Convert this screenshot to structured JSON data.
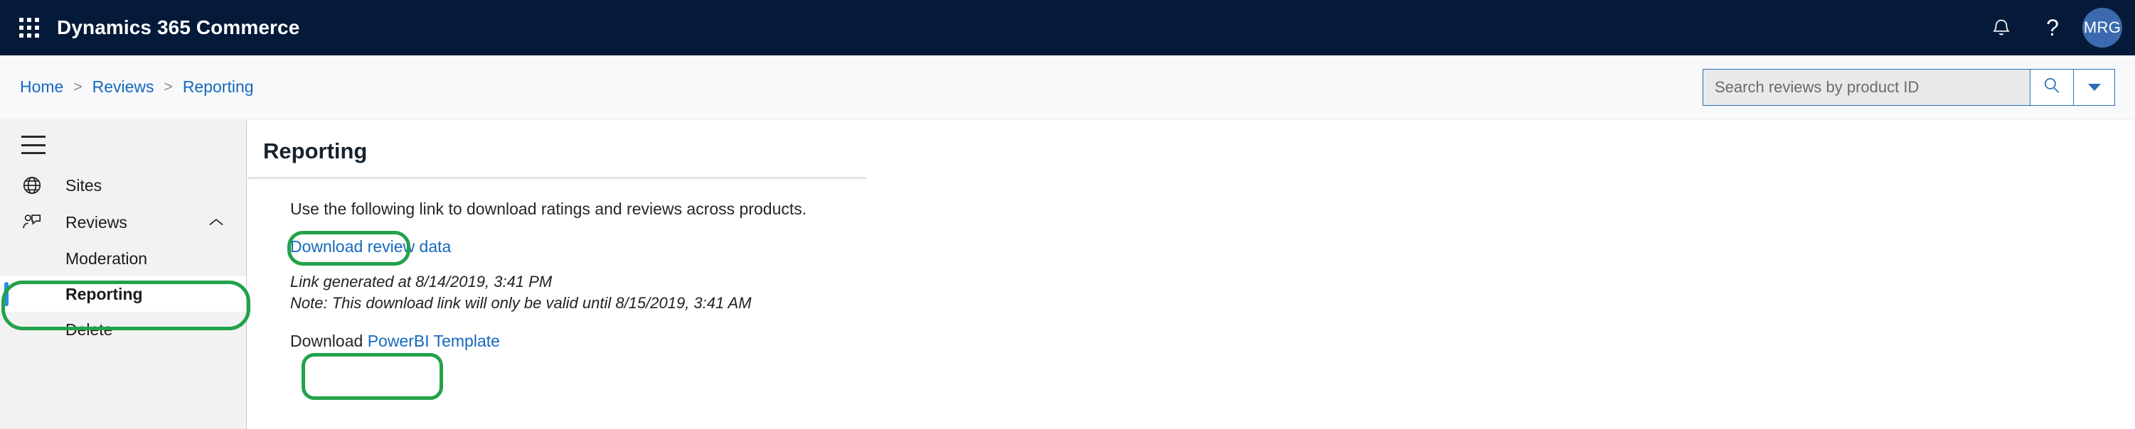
{
  "appbar": {
    "waffle_icon": "app-launcher-icon",
    "title": "Dynamics 365 Commerce",
    "notifications_icon": "bell-icon",
    "help_icon": "question-mark-icon",
    "help_label": "?",
    "avatar_initials": "MRG"
  },
  "breadcrumb": {
    "items": [
      {
        "label": "Home"
      },
      {
        "label": "Reviews"
      },
      {
        "label": "Reporting"
      }
    ],
    "separator": ">"
  },
  "search": {
    "value": "",
    "placeholder": "Search reviews by product ID",
    "search_icon": "magnifier-icon",
    "dropdown_icon": "chevron-down-icon"
  },
  "sidebar": {
    "menu_icon": "hamburger-icon",
    "items": [
      {
        "label": "Sites",
        "icon": "globe-icon"
      },
      {
        "label": "Reviews",
        "icon": "person-comment-icon",
        "expand_icon": "chevron-up-icon"
      }
    ],
    "sub_items": [
      {
        "label": "Moderation",
        "selected": false
      },
      {
        "label": "Reporting",
        "selected": true
      },
      {
        "label": "Delete",
        "selected": false
      }
    ]
  },
  "main": {
    "title": "Reporting",
    "intro": "Use the following link to download ratings and reviews across products.",
    "download_review_data_label": "Download review data",
    "link_generated_text": "Link generated at 8/14/2019, 3:41 PM",
    "link_validity_text": "Note: This download link will only be valid until 8/15/2019, 3:41 AM",
    "powerbi_prefix": "Download ",
    "powerbi_link_label": "PowerBI Template"
  },
  "annotations": {
    "color": "#22a24a",
    "targets": [
      "sidebar-item-reporting",
      "download-review-data-link",
      "download-powerbi-template"
    ]
  },
  "colors": {
    "appbar_bg": "#041A38",
    "link_blue": "#1569bf",
    "accent_blue": "#2a8dea",
    "sidebar_bg": "#f2f2f2",
    "annotation_green": "#22a24a"
  }
}
